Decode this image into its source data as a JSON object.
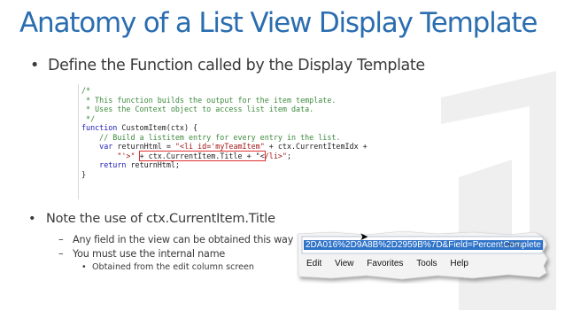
{
  "title": "Anatomy of a List View Display Template",
  "bullet1": {
    "marker": "•",
    "text": "Define the Function called by the Display Template"
  },
  "code": [
    {
      "parts": [
        {
          "cls": "cm",
          "t": "/*"
        }
      ]
    },
    {
      "parts": [
        {
          "cls": "cm",
          "t": " * This function builds the output for the item template."
        }
      ]
    },
    {
      "parts": [
        {
          "cls": "cm",
          "t": " * Uses the Context object to access list item data."
        }
      ]
    },
    {
      "parts": [
        {
          "cls": "cm",
          "t": " */"
        }
      ]
    },
    {
      "parts": [
        {
          "cls": "kw",
          "t": "function"
        },
        {
          "cls": "tx",
          "t": " CustomItem(ctx) {"
        }
      ]
    },
    {
      "parts": [
        {
          "cls": "cm",
          "t": "    // Build a listitem entry for every entry in the list."
        }
      ]
    },
    {
      "parts": [
        {
          "cls": "tx",
          "t": "    "
        },
        {
          "cls": "kw",
          "t": "var"
        },
        {
          "cls": "tx",
          "t": " returnHtml = "
        },
        {
          "cls": "st",
          "t": "\"<li id='myTeamItem\""
        },
        {
          "cls": "tx",
          "t": " + ctx.CurrentItemIdx +"
        }
      ]
    },
    {
      "parts": [
        {
          "cls": "tx",
          "t": "        "
        },
        {
          "cls": "st",
          "t": "\"'>\""
        },
        {
          "cls": "tx",
          "t": " "
        },
        {
          "cls": "tx redbox",
          "t": "+ ctx.CurrentItem.Title + \"<"
        },
        {
          "cls": "st",
          "t": "/li>\""
        },
        {
          "cls": "tx",
          "t": ";"
        }
      ]
    },
    {
      "parts": [
        {
          "cls": "tx",
          "t": "    "
        },
        {
          "cls": "kw",
          "t": "return"
        },
        {
          "cls": "tx",
          "t": " returnHtml;"
        }
      ]
    },
    {
      "parts": [
        {
          "cls": "tx",
          "t": "}"
        }
      ]
    }
  ],
  "bullet2": {
    "marker": "•",
    "text": "Note the use of ctx.CurrentItem.Title"
  },
  "sub1": {
    "marker": "–",
    "text": "Any field in the view can be obtained this way"
  },
  "sub2": {
    "marker": "–",
    "text": "You must use the internal name"
  },
  "subsub": {
    "marker": "•",
    "text": "Obtained from the edit column screen"
  },
  "browser": {
    "url": "2DA016%2D9A8B%2D2959B%7D&Field=PercentComplete",
    "icons": "⌕ ▾ ↻",
    "menu": [
      "Edit",
      "View",
      "Favorites",
      "Tools",
      "Help"
    ]
  }
}
